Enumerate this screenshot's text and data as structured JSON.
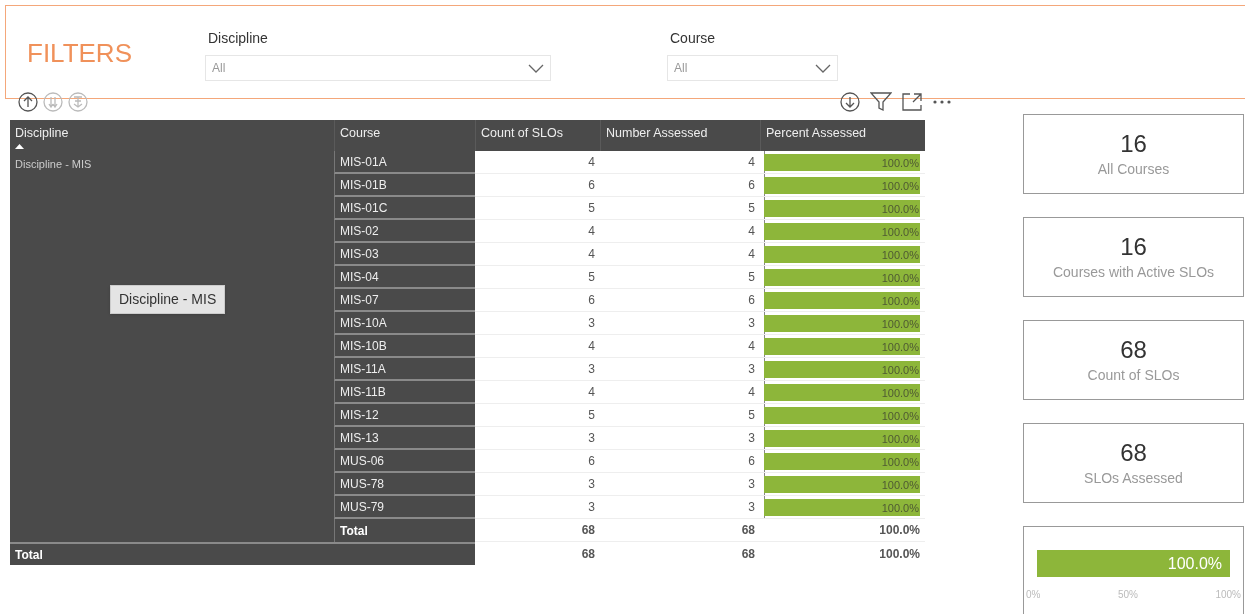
{
  "filters": {
    "title": "FILTERS",
    "slicers": [
      {
        "label": "Discipline",
        "value": "All"
      },
      {
        "label": "Course",
        "value": "All"
      }
    ]
  },
  "table": {
    "columns": [
      "Discipline",
      "Course",
      "Count of SLOs",
      "Number Assessed",
      "Percent Assessed"
    ],
    "groups": [
      {
        "discipline": "Discipline - MIS",
        "rows": [
          {
            "course": "MIS-01A",
            "count": "4",
            "assessed": "4",
            "percent": "100.0%",
            "level": 1
          },
          {
            "course": "MIS-01B",
            "count": "6",
            "assessed": "6",
            "percent": "100.0%",
            "level": 1
          },
          {
            "course": "MIS-01C",
            "count": "5",
            "assessed": "5",
            "percent": "100.0%",
            "level": 1
          },
          {
            "course": "MIS-02",
            "count": "4",
            "assessed": "4",
            "percent": "100.0%",
            "level": 1
          },
          {
            "course": "MIS-03",
            "count": "4",
            "assessed": "4",
            "percent": "100.0%",
            "level": 1
          },
          {
            "course": "MIS-04",
            "count": "5",
            "assessed": "5",
            "percent": "100.0%",
            "level": 1
          },
          {
            "course": "MIS-07",
            "count": "6",
            "assessed": "6",
            "percent": "100.0%",
            "level": 1
          },
          {
            "course": "MIS-10A",
            "count": "3",
            "assessed": "3",
            "percent": "100.0%",
            "level": 1
          },
          {
            "course": "MIS-10B",
            "count": "4",
            "assessed": "4",
            "percent": "100.0%",
            "level": 1
          },
          {
            "course": "MIS-11A",
            "count": "3",
            "assessed": "3",
            "percent": "100.0%",
            "level": 1
          },
          {
            "course": "MIS-11B",
            "count": "4",
            "assessed": "4",
            "percent": "100.0%",
            "level": 1
          },
          {
            "course": "MIS-12",
            "count": "5",
            "assessed": "5",
            "percent": "100.0%",
            "level": 1
          },
          {
            "course": "MIS-13",
            "count": "3",
            "assessed": "3",
            "percent": "100.0%",
            "level": 1
          },
          {
            "course": "MUS-06",
            "count": "6",
            "assessed": "6",
            "percent": "100.0%",
            "level": 1
          },
          {
            "course": "MUS-78",
            "count": "3",
            "assessed": "3",
            "percent": "100.0%",
            "level": 1
          },
          {
            "course": "MUS-79",
            "count": "3",
            "assessed": "3",
            "percent": "100.0%",
            "level": 1
          }
        ],
        "subtotal": {
          "label": "Total",
          "count": "68",
          "assessed": "68",
          "percent": "100.0%"
        }
      }
    ],
    "total": {
      "label": "Total",
      "count": "68",
      "assessed": "68",
      "percent": "100.0%"
    },
    "tooltip": "Discipline - MIS"
  },
  "cards": [
    {
      "kind": "number",
      "value": "16",
      "label": "All Courses"
    },
    {
      "kind": "number",
      "value": "16",
      "label": "Courses with Active SLOs"
    },
    {
      "kind": "number",
      "value": "68",
      "label": "Count of SLOs"
    },
    {
      "kind": "number",
      "value": "68",
      "label": "SLOs Assessed"
    },
    {
      "kind": "gauge",
      "value": "100.0%",
      "ticks": [
        "0%",
        "50%",
        "100%"
      ]
    }
  ]
}
